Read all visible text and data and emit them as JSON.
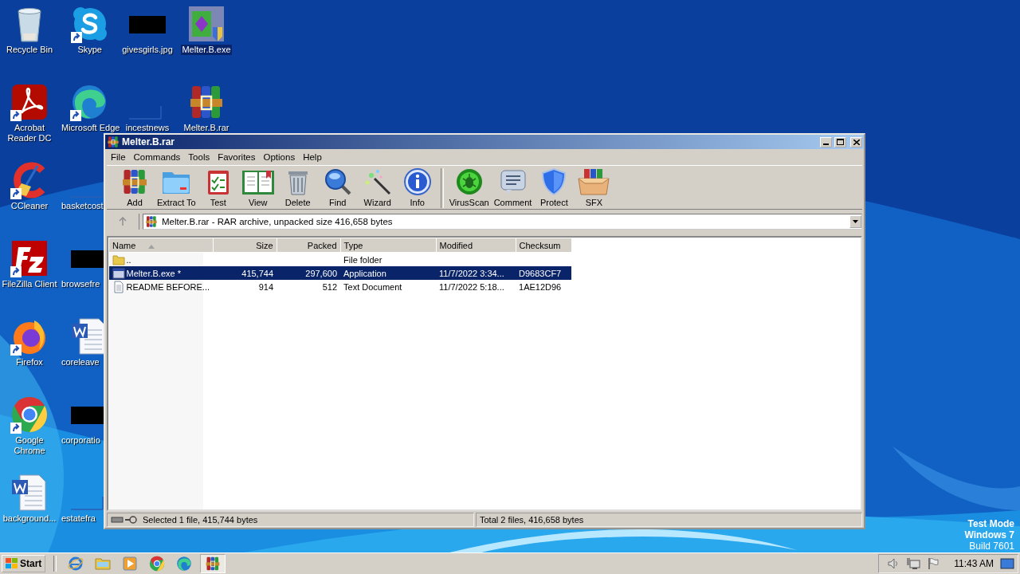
{
  "desktop": {
    "columns": [
      [
        {
          "label": "Recycle Bin",
          "kind": "recycle",
          "shortcut": false,
          "selected": false
        },
        {
          "label": "Acrobat Reader DC",
          "kind": "pdf",
          "shortcut": true,
          "selected": false
        },
        {
          "label": "CCleaner",
          "kind": "ccleaner",
          "shortcut": true,
          "selected": false
        },
        {
          "label": "FileZilla Client",
          "kind": "filezilla",
          "shortcut": true,
          "selected": false
        },
        {
          "label": "Firefox",
          "kind": "firefox",
          "shortcut": true,
          "selected": false
        },
        {
          "label": "Google Chrome",
          "kind": "chrome",
          "shortcut": true,
          "selected": false
        },
        {
          "label": "background...",
          "kind": "word",
          "shortcut": false,
          "selected": false
        }
      ],
      [
        {
          "label": "Skype",
          "kind": "skype",
          "shortcut": true,
          "selected": false
        },
        {
          "label": "Microsoft Edge",
          "kind": "edge",
          "shortcut": true,
          "selected": false
        },
        {
          "label": "basketcost",
          "kind": "blank",
          "shortcut": false,
          "selected": false
        },
        {
          "label": "browsefre",
          "kind": "redacted",
          "shortcut": false,
          "selected": false
        },
        {
          "label": "coreleave",
          "kind": "word",
          "shortcut": false,
          "selected": false
        },
        {
          "label": "corporatio",
          "kind": "redacted",
          "shortcut": false,
          "selected": false
        },
        {
          "label": "estatefra",
          "kind": "blank",
          "shortcut": false,
          "selected": false
        }
      ],
      [
        {
          "label": "givesgirls.jpg",
          "kind": "redacted",
          "shortcut": false,
          "selected": false
        },
        {
          "label": "incestnews",
          "kind": "blank",
          "shortcut": false,
          "selected": false
        }
      ],
      [
        {
          "label": "Melter.B.exe",
          "kind": "exe",
          "shortcut": false,
          "selected": true
        },
        {
          "label": "Melter.B.rar",
          "kind": "rar",
          "shortcut": false,
          "selected": false
        }
      ]
    ],
    "system_text": [
      "Test Mode",
      "Windows 7",
      "Build 7601"
    ]
  },
  "window": {
    "title": "Melter.B.rar",
    "menu": [
      "File",
      "Commands",
      "Tools",
      "Favorites",
      "Options",
      "Help"
    ],
    "toolbar": [
      [
        {
          "label": "Add",
          "kind": "add"
        },
        {
          "label": "Extract To",
          "kind": "extract"
        },
        {
          "label": "Test",
          "kind": "test"
        },
        {
          "label": "View",
          "kind": "view"
        },
        {
          "label": "Delete",
          "kind": "delete"
        },
        {
          "label": "Find",
          "kind": "find"
        },
        {
          "label": "Wizard",
          "kind": "wizard"
        },
        {
          "label": "Info",
          "kind": "info"
        }
      ],
      [
        {
          "label": "VirusScan",
          "kind": "virus"
        },
        {
          "label": "Comment",
          "kind": "comment"
        },
        {
          "label": "Protect",
          "kind": "protect"
        },
        {
          "label": "SFX",
          "kind": "sfx"
        }
      ]
    ],
    "address": "Melter.B.rar - RAR archive, unpacked size 416,658 bytes",
    "table": {
      "columns": [
        {
          "label": "Name",
          "sorted": true
        },
        {
          "label": "Size",
          "sorted": false
        },
        {
          "label": "Packed",
          "sorted": false
        },
        {
          "label": "Type",
          "sorted": false
        },
        {
          "label": "Modified",
          "sorted": false
        },
        {
          "label": "Checksum",
          "sorted": false
        }
      ],
      "rows": [
        {
          "kind": "folder",
          "selected": false,
          "cells": [
            "..",
            "",
            "",
            "File folder",
            "",
            ""
          ]
        },
        {
          "kind": "exe",
          "selected": true,
          "cells": [
            "Melter.B.exe *",
            "415,744",
            "297,600",
            "Application",
            "11/7/2022 3:34...",
            "D9683CF7"
          ]
        },
        {
          "kind": "text",
          "selected": false,
          "cells": [
            "README BEFORE...",
            "914",
            "512",
            "Text Document",
            "11/7/2022 5:18...",
            "1AE12D96"
          ]
        }
      ]
    },
    "status_bar": [
      "Selected 1 file, 415,744 bytes",
      "Total 2 files, 416,658 bytes"
    ]
  },
  "taskbar": {
    "start": "Start",
    "items": [
      {
        "kind": "ie",
        "selected": false
      },
      {
        "kind": "explorer",
        "selected": false
      },
      {
        "kind": "media",
        "selected": false
      },
      {
        "kind": "chrome",
        "selected": false
      },
      {
        "kind": "edge",
        "selected": false
      },
      {
        "kind": "rar",
        "selected": true
      }
    ],
    "clock": "11:43 AM"
  }
}
